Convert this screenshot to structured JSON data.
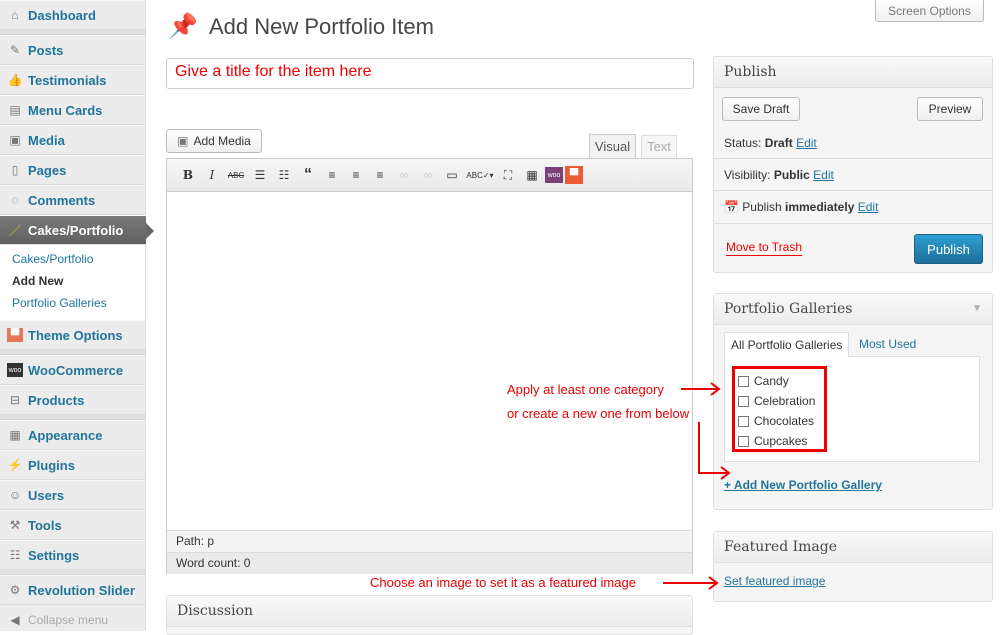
{
  "sidebar": {
    "items": [
      {
        "label": "Dashboard",
        "icon": "home-icon"
      },
      {
        "label": "Posts",
        "icon": "pin-icon"
      },
      {
        "label": "Testimonials",
        "icon": "thumbs-up-icon"
      },
      {
        "label": "Menu Cards",
        "icon": "book-icon"
      },
      {
        "label": "Media",
        "icon": "media-icon"
      },
      {
        "label": "Pages",
        "icon": "pages-icon"
      },
      {
        "label": "Comments",
        "icon": "comment-icon"
      },
      {
        "label": "Cakes/Portfolio",
        "icon": "brush-icon"
      },
      {
        "label": "Theme Options",
        "icon": "chef-hat-icon"
      },
      {
        "label": "WooCommerce",
        "icon": "woo-icon"
      },
      {
        "label": "Products",
        "icon": "cart-icon"
      },
      {
        "label": "Appearance",
        "icon": "appearance-icon"
      },
      {
        "label": "Plugins",
        "icon": "plug-icon"
      },
      {
        "label": "Users",
        "icon": "users-icon"
      },
      {
        "label": "Tools",
        "icon": "tools-icon"
      },
      {
        "label": "Settings",
        "icon": "settings-icon"
      },
      {
        "label": "Revolution Slider",
        "icon": "gear-icon"
      }
    ],
    "submenu": [
      "Cakes/Portfolio",
      "Add New",
      "Portfolio Galleries"
    ],
    "collapse": "Collapse menu"
  },
  "header": {
    "title": "Add New Portfolio Item",
    "screen_options": "Screen Options"
  },
  "title_input": {
    "value": "Give a title for the item here"
  },
  "editor": {
    "add_media": "Add Media",
    "tab_visual": "Visual",
    "tab_text": "Text",
    "path": "Path: p",
    "word_count": "Word count: 0"
  },
  "discussion": {
    "title": "Discussion"
  },
  "publish": {
    "title": "Publish",
    "save_draft": "Save Draft",
    "preview": "Preview",
    "status_label": "Status:",
    "status": "Draft",
    "visibility_label": "Visibility:",
    "visibility": "Public",
    "publish_label": "Publish",
    "publish_when": "immediately",
    "edit": "Edit",
    "trash": "Move to Trash",
    "publish_button": "Publish"
  },
  "galleries": {
    "title": "Portfolio Galleries",
    "tab_all": "All Portfolio Galleries",
    "tab_most": "Most Used",
    "items": [
      "Candy",
      "Celebration",
      "Chocolates",
      "Cupcakes"
    ],
    "add_new": "+ Add New Portfolio Gallery"
  },
  "featured": {
    "title": "Featured Image",
    "link": "Set featured image"
  },
  "annotations": {
    "category_1": "Apply at least one category",
    "category_2": "or create a new one from below",
    "featured": "Choose an image to set it as a featured image"
  },
  "colors": {
    "link": "#21759b",
    "annotation": "#e00000",
    "publish_button": "#2a8bbc"
  }
}
